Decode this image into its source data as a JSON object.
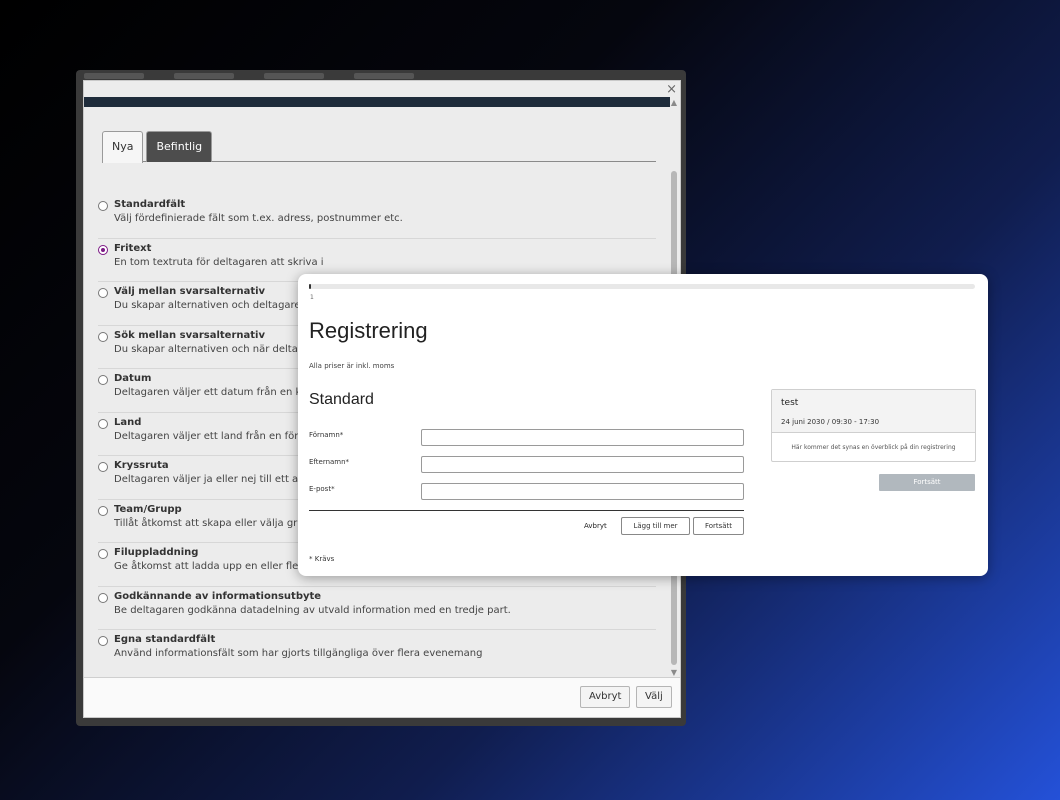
{
  "dialog": {
    "close_glyph": "×",
    "tabs": [
      {
        "label": "Nya",
        "active": true
      },
      {
        "label": "Befintlig",
        "active": false
      }
    ],
    "options": [
      {
        "title": "Standardfält",
        "desc": "Välj fördefinierade fält som t.ex. adress, postnummer etc.",
        "checked": false
      },
      {
        "title": "Fritext",
        "desc": "En tom textruta för deltagaren att skriva i",
        "checked": true
      },
      {
        "title": "Välj mellan svarsalternativ",
        "desc": "Du skapar alternativen och deltagaren ka",
        "checked": false
      },
      {
        "title": "Sök mellan svarsalternativ",
        "desc": "Du skapar alternativen och när deltagare",
        "checked": false
      },
      {
        "title": "Datum",
        "desc": "Deltagaren väljer ett datum från en kale",
        "checked": false
      },
      {
        "title": "Land",
        "desc": "Deltagaren väljer ett land från en fördefin",
        "checked": false
      },
      {
        "title": "Kryssruta",
        "desc": "Deltagaren väljer ja eller nej till ett alterna",
        "checked": false
      },
      {
        "title": "Team/Grupp",
        "desc": "Tillåt åtkomst att skapa eller välja gruppe",
        "checked": false
      },
      {
        "title": "Filuppladdning",
        "desc": "Ge åtkomst att ladda upp en eller flera fil",
        "checked": false
      },
      {
        "title": "Godkännande av informationsutbyte",
        "desc": "Be deltagaren godkänna datadelning av utvald information med en tredje part.",
        "checked": false
      },
      {
        "title": "Egna standardfält",
        "desc": "Använd informationsfält som har gjorts tillgängliga över flera evenemang",
        "checked": false
      }
    ],
    "footer": {
      "cancel_label": "Avbryt",
      "select_label": "Välj"
    }
  },
  "registration": {
    "progress_percent": 0.3,
    "step_label": "1",
    "title": "Registrering",
    "subtitle": "Alla priser är inkl. moms",
    "section": "Standard",
    "fields": [
      {
        "label": "Förnamn*",
        "value": ""
      },
      {
        "label": "Efternamn*",
        "value": ""
      },
      {
        "label": "E-post*",
        "value": ""
      }
    ],
    "actions": {
      "cancel": "Avbryt",
      "add_more": "Lägg till mer",
      "continue": "Fortsätt"
    },
    "required_note": "* Krävs",
    "summary": {
      "name": "test",
      "date": "24 juni 2030 / 09:30 - 17:30",
      "text": "Här kommer det synas en överblick på din registrering"
    },
    "summary_continue": "Fortsätt"
  }
}
